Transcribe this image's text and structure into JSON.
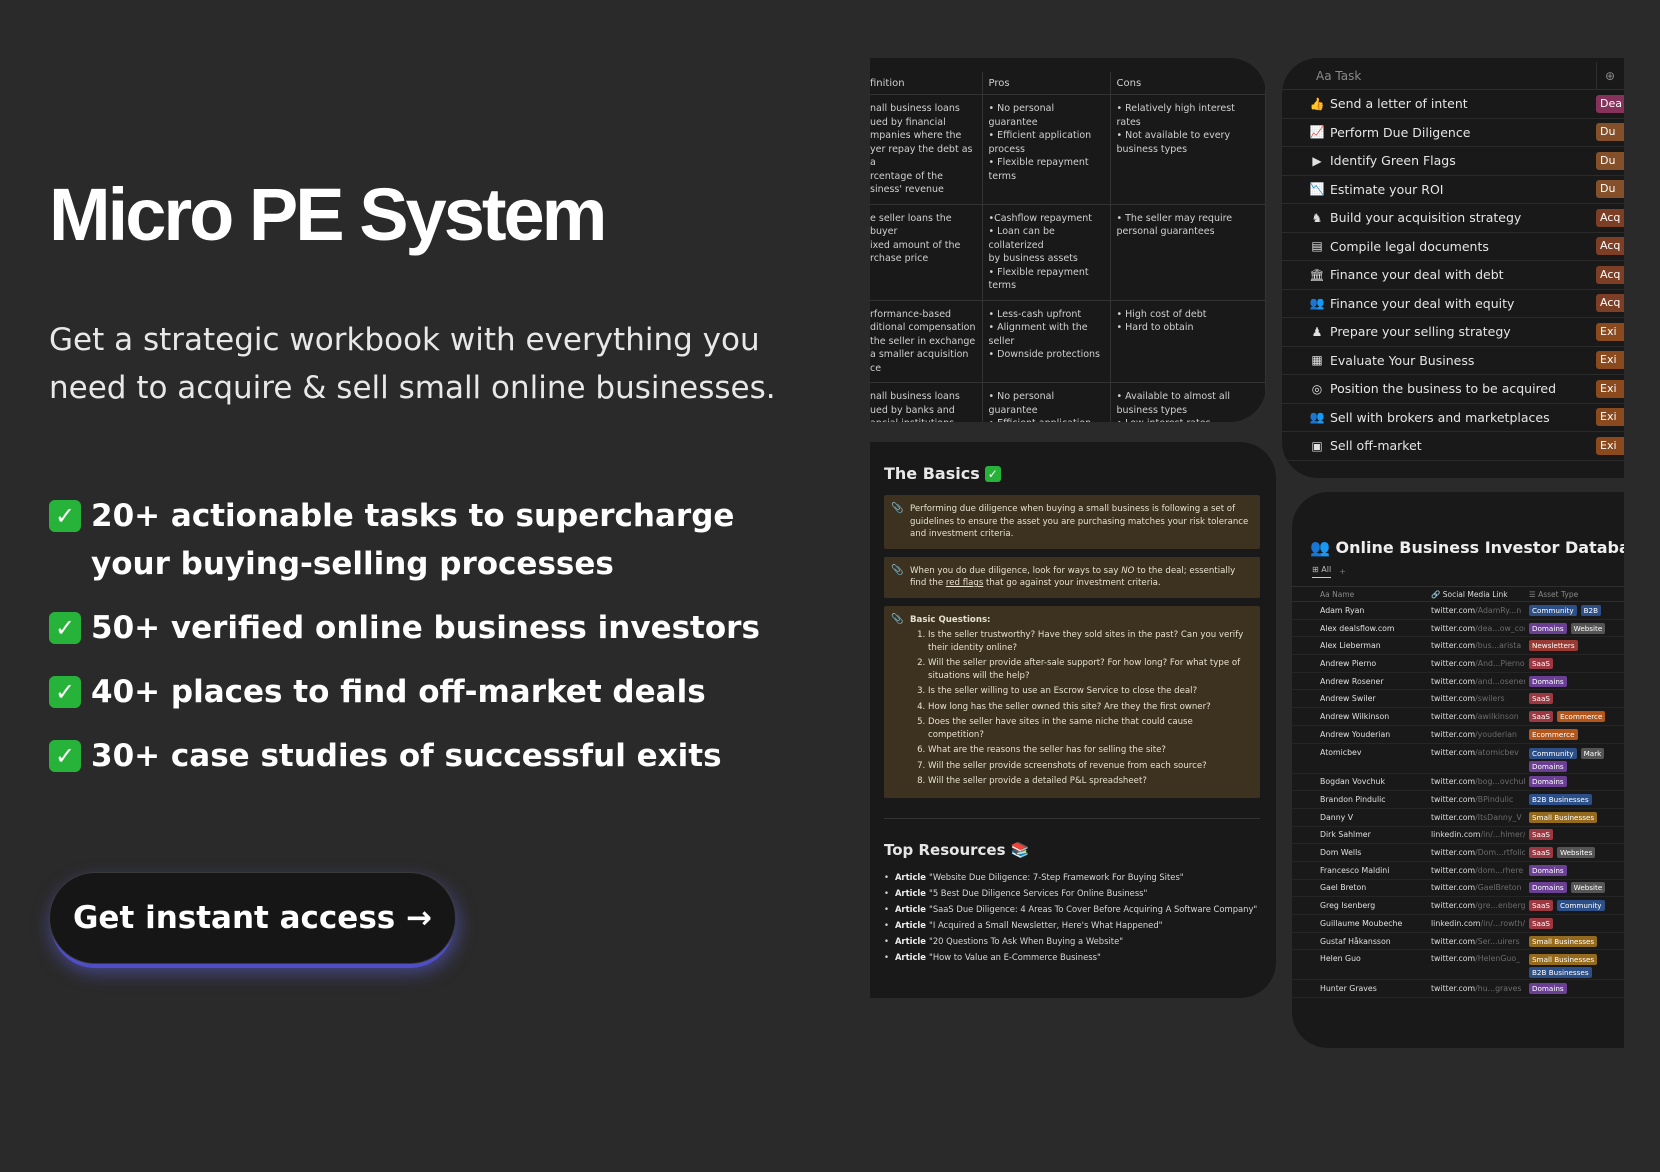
{
  "hero": {
    "title": "Micro PE System",
    "subtitle": "Get a strategic workbook with everything you need to acquire & sell small online businesses.",
    "check_glyph": "✓",
    "features": [
      {
        "text": "20+ actionable tasks to supercharge your buying-selling processes"
      },
      {
        "text": "50+ verified online business investors"
      },
      {
        "text": "40+ places to find off-market deals"
      },
      {
        "text": "30+ case studies of successful exits"
      }
    ],
    "cta_label": "Get instant access →"
  },
  "financing_table": {
    "columns": [
      "finition",
      "Pros",
      "Cons"
    ],
    "rows": [
      {
        "def": "nall business loans\nued by financial\nmpanies where the\nyer repay the debt as a\nrcentage of the\nsiness' revenue",
        "pros": "• No personal guarantee\n• Efficient application\nprocess\n• Flexible repayment\nterms",
        "cons": "• Relatively high interest\nrates\n• Not available to every\nbusiness types"
      },
      {
        "def": "e seller loans the buyer\nixed amount of the\nrchase price",
        "pros": "•Cashflow repayment\n• Loan can be collaterized\nby business assets\n• Flexible repayment\nterms",
        "cons": "• The seller may require\npersonal guarantees"
      },
      {
        "def": "rformance-based\nditional compensation\nthe seller in exchange\na smaller acquisition\nce",
        "pros": "• Less-cash upfront\n• Alignment with the\nseller\n• Downside protections",
        "cons": "• High cost of debt\n• Hard to obtain"
      },
      {
        "def": "nall business loans\nued by banks and\nancial institutions",
        "pros": "• No personal guarantee\n• Efficient application\nprocess\n• Flexible repayment",
        "cons": "• Available to almost all\nbusiness types\n• Low interest rates\n• Long repayment period"
      }
    ]
  },
  "tasks": {
    "header": "Aa Task",
    "items": [
      {
        "icon": "👍",
        "label": "Send a letter of intent",
        "tag": "Dea",
        "tag_class": "tag-de"
      },
      {
        "icon": "📈",
        "label": "Perform Due Diligence",
        "tag": "Du",
        "tag_class": "tag-du"
      },
      {
        "icon": "▶",
        "label": "Identify Green Flags",
        "tag": "Du",
        "tag_class": "tag-du"
      },
      {
        "icon": "📉",
        "label": "Estimate your ROI",
        "tag": "Du",
        "tag_class": "tag-du"
      },
      {
        "icon": "♞",
        "label": "Build your acquisition strategy",
        "tag": "Acq",
        "tag_class": "tag-ac"
      },
      {
        "icon": "▤",
        "label": "Compile legal documents",
        "tag": "Acq",
        "tag_class": "tag-ac"
      },
      {
        "icon": "🏛",
        "label": "Finance your deal with debt",
        "tag": "Acq",
        "tag_class": "tag-ac"
      },
      {
        "icon": "👥",
        "label": "Finance your deal with equity",
        "tag": "Acq",
        "tag_class": "tag-ac"
      },
      {
        "icon": "♟",
        "label": "Prepare your selling strategy",
        "tag": "Exi",
        "tag_class": "tag-ex"
      },
      {
        "icon": "▦",
        "label": "Evaluate Your Business",
        "tag": "Exi",
        "tag_class": "tag-ex"
      },
      {
        "icon": "◎",
        "label": "Position the business to be acquired",
        "tag": "Exi",
        "tag_class": "tag-ex"
      },
      {
        "icon": "👥",
        "label": "Sell with brokers and marketplaces",
        "tag": "Exi",
        "tag_class": "tag-ex"
      },
      {
        "icon": "▣",
        "label": "Sell off-market",
        "tag": "Exi",
        "tag_class": "tag-ex"
      }
    ]
  },
  "basics": {
    "title": "The Basics",
    "callout1": "Performing due diligence when buying a small business is following a set of guidelines to ensure the asset you are purchasing matches your risk tolerance and investment criteria.",
    "callout2_pre": "When you do due diligence, look for ways to say ",
    "callout2_em": "NO",
    "callout2_mid": " to the deal; essentially find the ",
    "callout2_link": "red flags",
    "callout2_post": " that go against your investment criteria.",
    "questions_title": "Basic Questions:",
    "questions": [
      "Is the seller trustworthy? Have they sold sites in the past? Can you verify their identity online?",
      "Will the seller provide after-sale support? For how long? For what type of situations will the help?",
      "Is the seller willing to use an Escrow Service to close the deal?",
      "How long has the seller owned this site? Are they the first owner?",
      "Does the seller have sites in the same niche that could cause competition?",
      "What are the reasons the seller has for selling the site?",
      "Will the seller provide screenshots of revenue from each source?",
      "Will the seller provide a detailed P&L spreadsheet?"
    ],
    "resources_title": "Top Resources 📚",
    "resources": [
      {
        "kind": "Article",
        "text": "\"Website Due Diligence: 7-Step Framework For Buying Sites\""
      },
      {
        "kind": "Article",
        "text": "\"5 Best Due Diligence Services For Online Business\""
      },
      {
        "kind": "Article",
        "text": "\"SaaS Due Diligence: 4 Areas To Cover Before Acquiring A Software Company\""
      },
      {
        "kind": "Article",
        "text": "\"I Acquired a Small Newsletter, Here's What Happened\""
      },
      {
        "kind": "Article",
        "text": "\"20 Questions To Ask When Buying a Website\""
      },
      {
        "kind": "Article",
        "text": "\"How to Value an E-Commerce Business\""
      }
    ]
  },
  "database": {
    "title": "👥 Online Business Investor Database",
    "view_label": "All",
    "add_label": "+",
    "col_name": "Aa Name",
    "col_social": "🔗 Social Media Link",
    "col_type": "☰ Asset Type",
    "rows": [
      {
        "name": "Adam Ryan",
        "site": "twitter.com",
        "handle": "/AdamRy...n",
        "tags": [
          [
            "Community",
            "p-com"
          ],
          [
            "B2B",
            "p-b2b"
          ]
        ]
      },
      {
        "name": "Alex dealsflow.com",
        "site": "twitter.com",
        "handle": "/dea...ow_com",
        "tags": [
          [
            "Domains",
            "p-dom"
          ],
          [
            "Website",
            "p-web"
          ]
        ]
      },
      {
        "name": "Alex Lieberman",
        "site": "twitter.com",
        "handle": "/bus...arista",
        "tags": [
          [
            "Newsletters",
            "p-news"
          ]
        ]
      },
      {
        "name": "Andrew Pierno",
        "site": "twitter.com",
        "handle": "/And...Pierno",
        "tags": [
          [
            "SaaS",
            "p-saas"
          ]
        ]
      },
      {
        "name": "Andrew Rosener",
        "site": "twitter.com",
        "handle": "/and...osener",
        "tags": [
          [
            "Domains",
            "p-dom"
          ]
        ]
      },
      {
        "name": "Andrew Swiler",
        "site": "twitter.com",
        "handle": "/swilers",
        "tags": [
          [
            "SaaS",
            "p-saas"
          ]
        ]
      },
      {
        "name": "Andrew Wilkinson",
        "site": "twitter.com",
        "handle": "/awilkinson",
        "tags": [
          [
            "SaaS",
            "p-saas"
          ],
          [
            "Ecommerce",
            "p-ecom"
          ]
        ]
      },
      {
        "name": "Andrew Youderian",
        "site": "twitter.com",
        "handle": "/youderian",
        "tags": [
          [
            "Ecommerce",
            "p-ecom"
          ]
        ]
      },
      {
        "name": "Atomicbev",
        "site": "twitter.com",
        "handle": "/atomicbev",
        "tall": true,
        "tags": [
          [
            "Community",
            "p-com"
          ],
          [
            "Mark",
            "p-mark"
          ],
          [
            "Domains",
            "p-dom"
          ]
        ]
      },
      {
        "name": "Bogdan Vovchuk",
        "site": "twitter.com",
        "handle": "/bog...ovchuk",
        "tags": [
          [
            "Domains",
            "p-dom"
          ]
        ]
      },
      {
        "name": "Brandon Pindulic",
        "site": "twitter.com",
        "handle": "/BPindulic",
        "tags": [
          [
            "B2B Businesses",
            "p-b2b"
          ]
        ]
      },
      {
        "name": "Danny V",
        "site": "twitter.com",
        "handle": "/ItsDanny_V",
        "tags": [
          [
            "Small Businesses",
            "p-small"
          ]
        ]
      },
      {
        "name": "Dirk Sahlmer",
        "site": "linkedin.com",
        "handle": "/in/...hlmer/",
        "tags": [
          [
            "SaaS",
            "p-saas"
          ]
        ]
      },
      {
        "name": "Dom Wells",
        "site": "twitter.com",
        "handle": "/Dom...rtfolio",
        "tags": [
          [
            "SaaS",
            "p-saas"
          ],
          [
            "Websites",
            "p-web"
          ]
        ]
      },
      {
        "name": "Francesco Maldini",
        "site": "twitter.com",
        "handle": "/dom...rhere",
        "tags": [
          [
            "Domains",
            "p-dom"
          ]
        ]
      },
      {
        "name": "Gael Breton",
        "site": "twitter.com",
        "handle": "/GaelBreton",
        "tags": [
          [
            "Domains",
            "p-dom"
          ],
          [
            "Website",
            "p-web"
          ]
        ]
      },
      {
        "name": "Greg Isenberg",
        "site": "twitter.com",
        "handle": "/gre...enberg",
        "tags": [
          [
            "SaaS",
            "p-saas"
          ],
          [
            "Community",
            "p-com"
          ]
        ]
      },
      {
        "name": "Guillaume Moubeche",
        "site": "linkedin.com",
        "handle": "/in/...rowth/",
        "tags": [
          [
            "SaaS",
            "p-saas"
          ]
        ]
      },
      {
        "name": "Gustaf Håkansson",
        "site": "twitter.com",
        "handle": "/Ser...uirers",
        "tags": [
          [
            "Small Businesses",
            "p-small"
          ]
        ]
      },
      {
        "name": "Helen Guo",
        "site": "twitter.com",
        "handle": "/HelenGuo_",
        "tall": true,
        "tags": [
          [
            "Small Businesses",
            "p-small"
          ],
          [
            "B2B Businesses",
            "p-b2b"
          ]
        ]
      },
      {
        "name": "Hunter Graves",
        "site": "twitter.com",
        "handle": "/hu...graves",
        "tags": [
          [
            "Domains",
            "p-dom"
          ]
        ]
      }
    ]
  }
}
